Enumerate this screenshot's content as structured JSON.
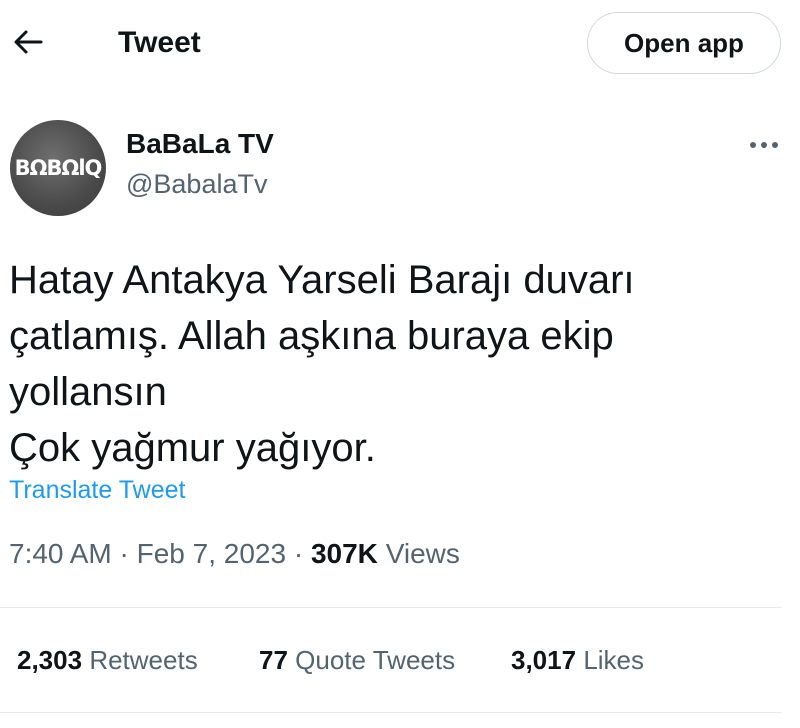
{
  "header": {
    "back_icon": "arrow-left-icon",
    "title": "Tweet",
    "open_app_label": "Open app"
  },
  "author": {
    "avatar_text": "BΩBΩlQ",
    "display_name": "BaBaLa TV",
    "handle": "@BabalaTv",
    "more_icon": "more-horizontal-icon"
  },
  "tweet": {
    "lines": [
      "Hatay Antakya Yarseli Barajı duvarı",
      "çatlamış. Allah aşkına buraya ekip",
      "yollansın",
      "Çok yağmur yağıyor."
    ],
    "translate_label": "Translate Tweet"
  },
  "meta": {
    "time": "7:40 AM",
    "separator": "·",
    "date": "Feb 7, 2023",
    "views_count": "307K",
    "views_label": "Views"
  },
  "stats": {
    "retweets_count": "2,303",
    "retweets_label": "Retweets",
    "quotes_count": "77",
    "quotes_label": "Quote Tweets",
    "likes_count": "3,017",
    "likes_label": "Likes"
  },
  "colors": {
    "link": "#1d9bf0",
    "secondary_text": "#536471",
    "primary_text": "#0f1419",
    "divider": "#e7eaee"
  }
}
